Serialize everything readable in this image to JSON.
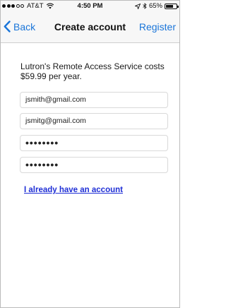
{
  "status_bar": {
    "carrier": "AT&T",
    "time": "4:50 PM",
    "battery_percent": "65%",
    "signal_bars_filled": 3,
    "signal_bars_total": 5,
    "icons": [
      "wifi-icon",
      "location-icon",
      "bluetooth-icon",
      "battery-icon"
    ]
  },
  "nav": {
    "back_label": "Back",
    "title": "Create account",
    "register_label": "Register",
    "accent_color": "#1a75d9"
  },
  "main": {
    "price_text": "Lutron's Remote Access Service costs $59.99 per year.",
    "fields": {
      "email": "jsmith@gmail.com",
      "confirm_email": "jsmitg@gmail.com",
      "password": "••••••••",
      "confirm_password": "••••••••"
    },
    "account_link": "I already have an account"
  }
}
